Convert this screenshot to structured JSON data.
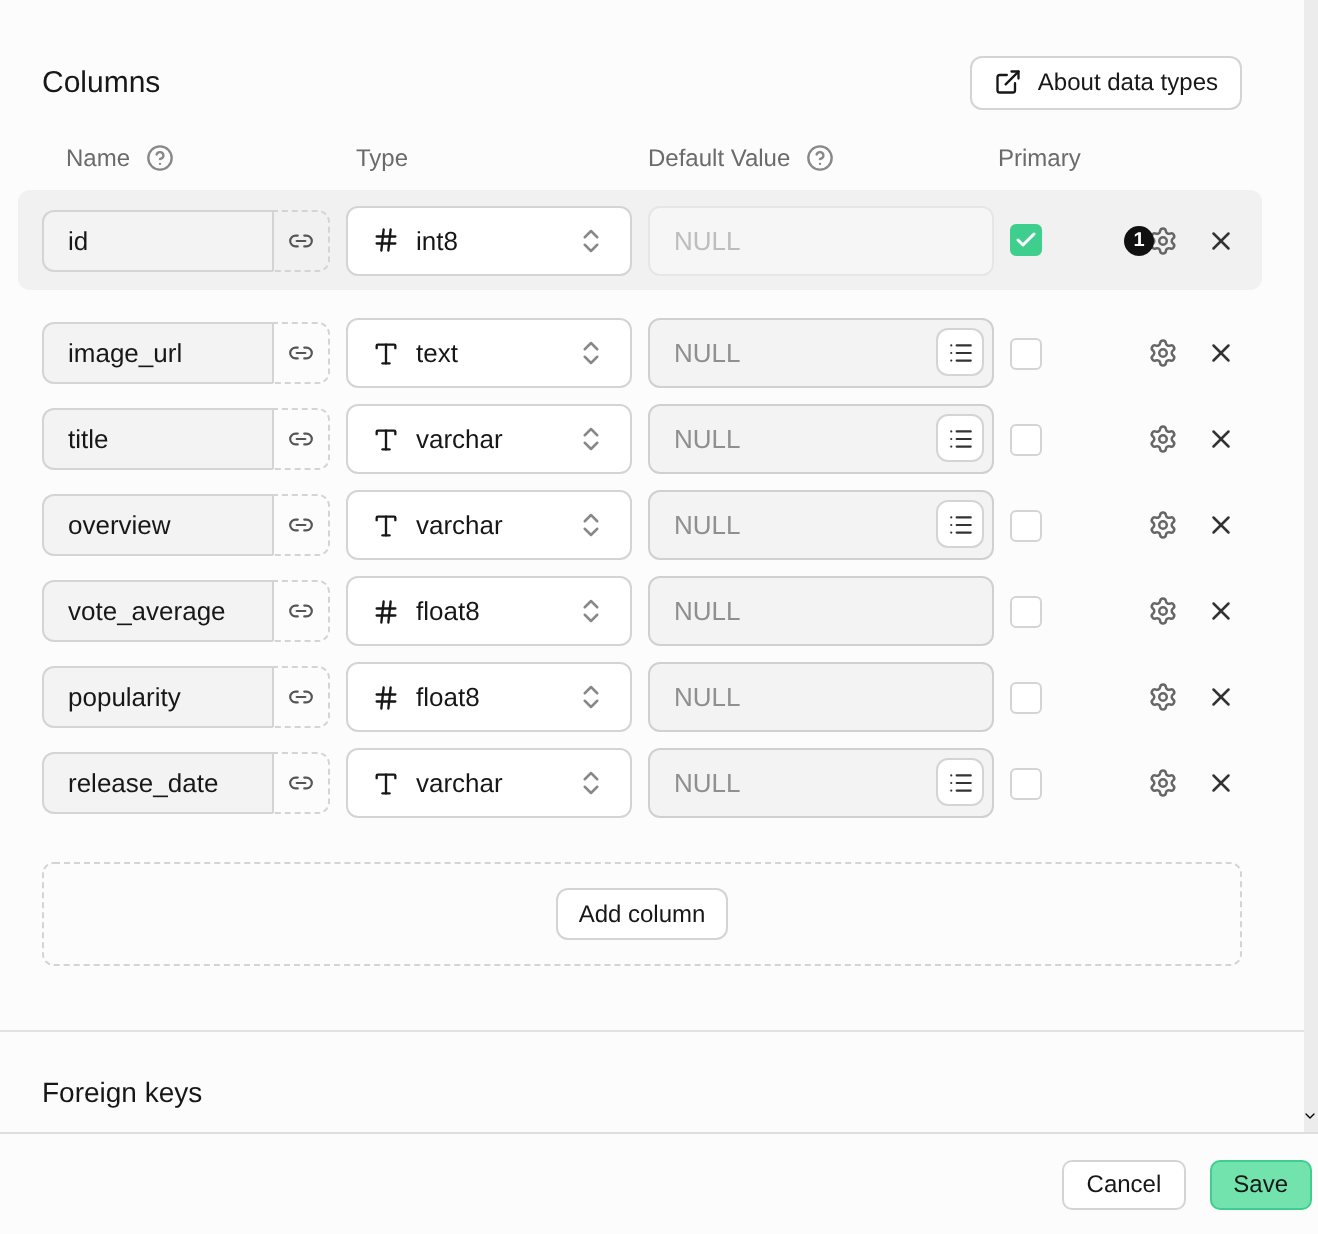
{
  "section": {
    "title": "Columns",
    "about_button": "About data types"
  },
  "headings": [
    {
      "label": "Name",
      "help": true
    },
    {
      "label": "Type",
      "help": false
    },
    {
      "label": "Default Value",
      "help": true
    },
    {
      "label": "Primary",
      "help": false
    }
  ],
  "columns": [
    {
      "name": "id",
      "kind": "number",
      "type": "int8",
      "placeholder": "NULL",
      "default_disabled": true,
      "list_button": false,
      "primary": true,
      "badge": "1"
    },
    {
      "name": "image_url",
      "kind": "text",
      "type": "text",
      "placeholder": "NULL",
      "default_disabled": false,
      "list_button": true,
      "primary": false
    },
    {
      "name": "title",
      "kind": "text",
      "type": "varchar",
      "placeholder": "NULL",
      "default_disabled": false,
      "list_button": true,
      "primary": false
    },
    {
      "name": "overview",
      "kind": "text",
      "type": "varchar",
      "placeholder": "NULL",
      "default_disabled": false,
      "list_button": true,
      "primary": false
    },
    {
      "name": "vote_average",
      "kind": "number",
      "type": "float8",
      "placeholder": "NULL",
      "default_disabled": false,
      "list_button": false,
      "primary": false
    },
    {
      "name": "popularity",
      "kind": "number",
      "type": "float8",
      "placeholder": "NULL",
      "default_disabled": false,
      "list_button": false,
      "primary": false
    },
    {
      "name": "release_date",
      "kind": "text",
      "type": "varchar",
      "placeholder": "NULL",
      "default_disabled": false,
      "list_button": true,
      "primary": false
    }
  ],
  "add_button": "Add column",
  "next_section": {
    "title": "Foreign keys"
  },
  "footer": {
    "cancel": "Cancel",
    "save": "Save"
  }
}
